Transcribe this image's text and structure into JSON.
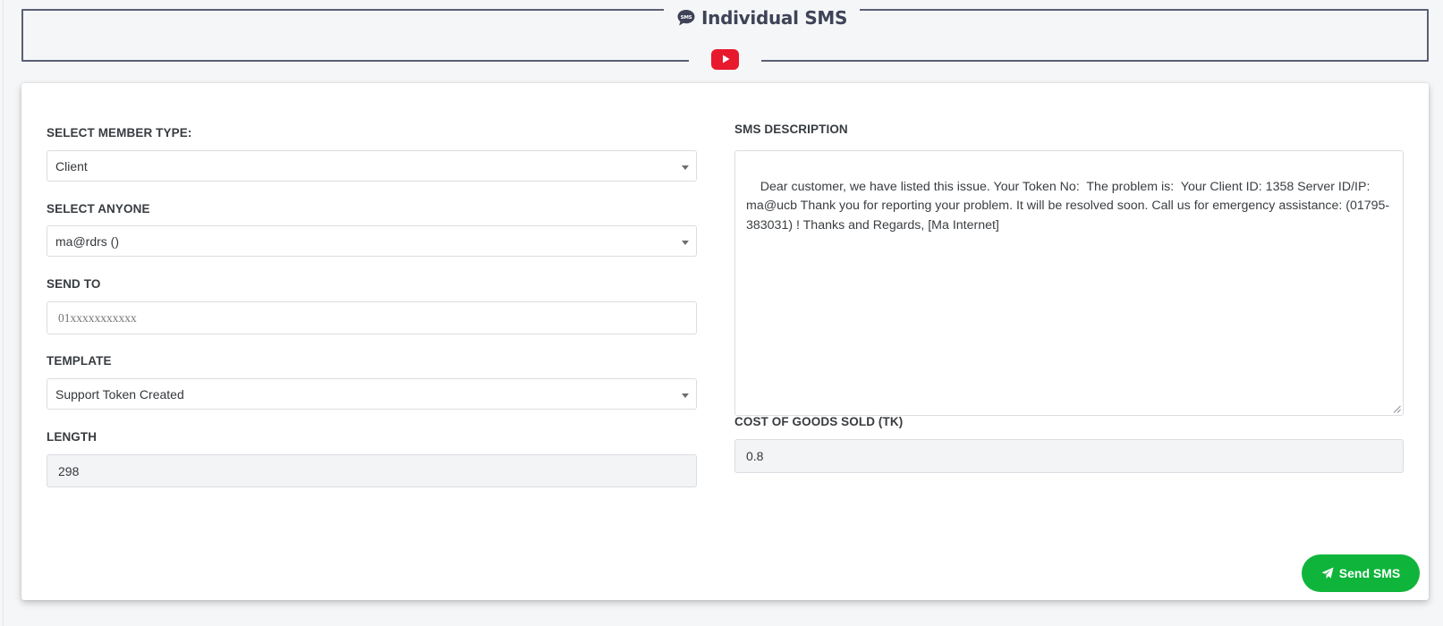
{
  "header": {
    "title": "Individual SMS",
    "title_icon": "sms-bubble-icon",
    "video_icon": "youtube-play-icon",
    "video_color": "#e8192c"
  },
  "form": {
    "member_type": {
      "label": "SELECT MEMBER TYPE:",
      "value": "Client"
    },
    "anyone": {
      "label": "SELECT ANYONE",
      "value": "ma@rdrs ()"
    },
    "send_to": {
      "label": "SEND TO",
      "placeholder": "01xxxxxxxxxxx"
    },
    "template": {
      "label": "TEMPLATE",
      "value": "Support Token Created"
    },
    "length": {
      "label": "LENGTH",
      "value": "298"
    },
    "sms_description": {
      "label": "SMS DESCRIPTION",
      "value": "Dear customer, we have listed this issue. Your Token No:  The problem is:  Your Client ID: 1358 Server ID/IP: ma@ucb Thank you for reporting your problem. It will be resolved soon. Call us for emergency assistance: (01795-383031) ! Thanks and Regards, [Ma Internet]"
    },
    "cogs": {
      "label": "COST OF GOODS SOLD (TK)",
      "value": "0.8"
    },
    "send_button": {
      "label": "Send SMS",
      "icon": "paper-plane-icon",
      "color": "#0fb53b"
    }
  }
}
